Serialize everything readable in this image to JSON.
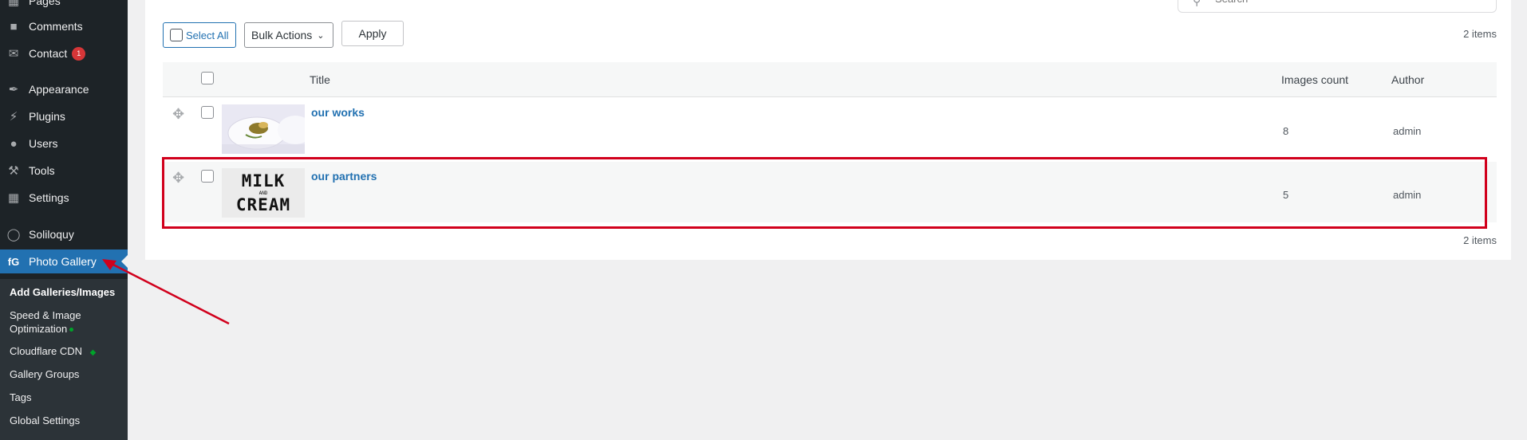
{
  "sidebar": {
    "items": [
      {
        "label": "Pages",
        "icon": "pages-icon"
      },
      {
        "label": "Comments",
        "icon": "comment-icon"
      },
      {
        "label": "Contact",
        "icon": "mail-icon",
        "badge": "1"
      },
      {
        "label": "Appearance",
        "icon": "paintbrush-icon"
      },
      {
        "label": "Plugins",
        "icon": "plugin-icon"
      },
      {
        "label": "Users",
        "icon": "user-icon"
      },
      {
        "label": "Tools",
        "icon": "wrench-icon"
      },
      {
        "label": "Settings",
        "icon": "settings-icon"
      },
      {
        "label": "Soliloquy",
        "icon": "soliloquy-icon"
      },
      {
        "label": "Photo Gallery",
        "icon": "photo-gallery-icon",
        "active": true
      }
    ],
    "submenu": [
      {
        "label": "Add Galleries/Images",
        "current": true
      },
      {
        "label": "Speed & Image Optimization"
      },
      {
        "label": "Cloudflare CDN"
      },
      {
        "label": "Gallery Groups"
      },
      {
        "label": "Tags"
      },
      {
        "label": "Global Settings"
      }
    ]
  },
  "toolbar": {
    "select_all_label": "Select All",
    "bulk_actions_label": "Bulk Actions",
    "apply_label": "Apply",
    "items_count": "2 items",
    "search_placeholder": "Search"
  },
  "table": {
    "columns": {
      "title": "Title",
      "images_count": "Images count",
      "author": "Author"
    },
    "rows": [
      {
        "title": "our works",
        "images_count": "8",
        "author": "admin"
      },
      {
        "title": "our partners",
        "images_count": "5",
        "author": "admin",
        "thumb_text_big_1": "MILK",
        "thumb_text_small": "AND",
        "thumb_text_big_2": "CREAM"
      }
    ]
  },
  "footer": {
    "items_count": "2 items"
  },
  "colors": {
    "accent": "#2271b1",
    "sidebar_bg": "#1d2327",
    "highlight": "#d1001c",
    "badge": "#d63638"
  }
}
